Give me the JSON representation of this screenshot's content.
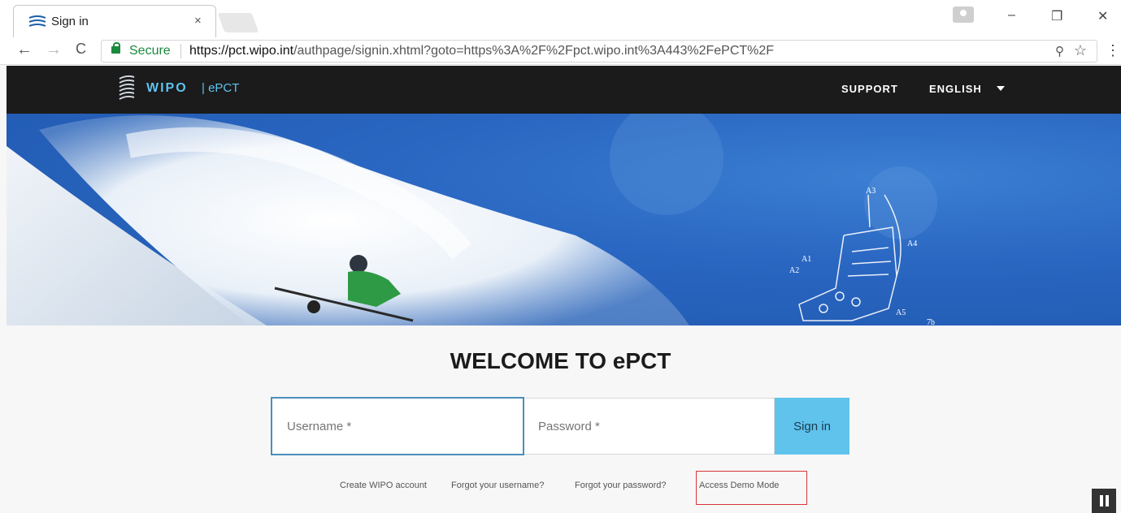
{
  "browser": {
    "tab_title": "Sign in",
    "tab_close": "×",
    "secure_label": "Secure",
    "url_host": "https://pct.wipo.int",
    "url_path": "/authpage/signin.xhtml?goto=https%3A%2F%2Fpct.wipo.int%3A443%2FePCT%2F",
    "nav": {
      "back": "←",
      "forward": "→",
      "reload": "C"
    },
    "window": {
      "minimize": "–",
      "restore": "❐",
      "close": "✕"
    },
    "icons": {
      "zoom": "zoom-icon",
      "star": "star-icon",
      "menu": "menu-icon"
    }
  },
  "header": {
    "logo_text": "WIPO",
    "logo_sub": "| ePCT",
    "support": "SUPPORT",
    "language": "ENGLISH"
  },
  "hero": {
    "labels": [
      "A3",
      "A4",
      "A1",
      "A2",
      "A5",
      "7b"
    ]
  },
  "main": {
    "welcome": "WELCOME TO ePCT",
    "username_placeholder": "Username *",
    "password_placeholder": "Password *",
    "signin_label": "Sign in"
  },
  "links": {
    "create": "Create WIPO account",
    "forgot_username": "Forgot your username?",
    "forgot_password": "Forgot your password?",
    "demo": "Access Demo Mode"
  },
  "colors": {
    "accent": "#5fc3ec",
    "header_bg": "#1b1b1b",
    "highlight": "#d9353a"
  }
}
